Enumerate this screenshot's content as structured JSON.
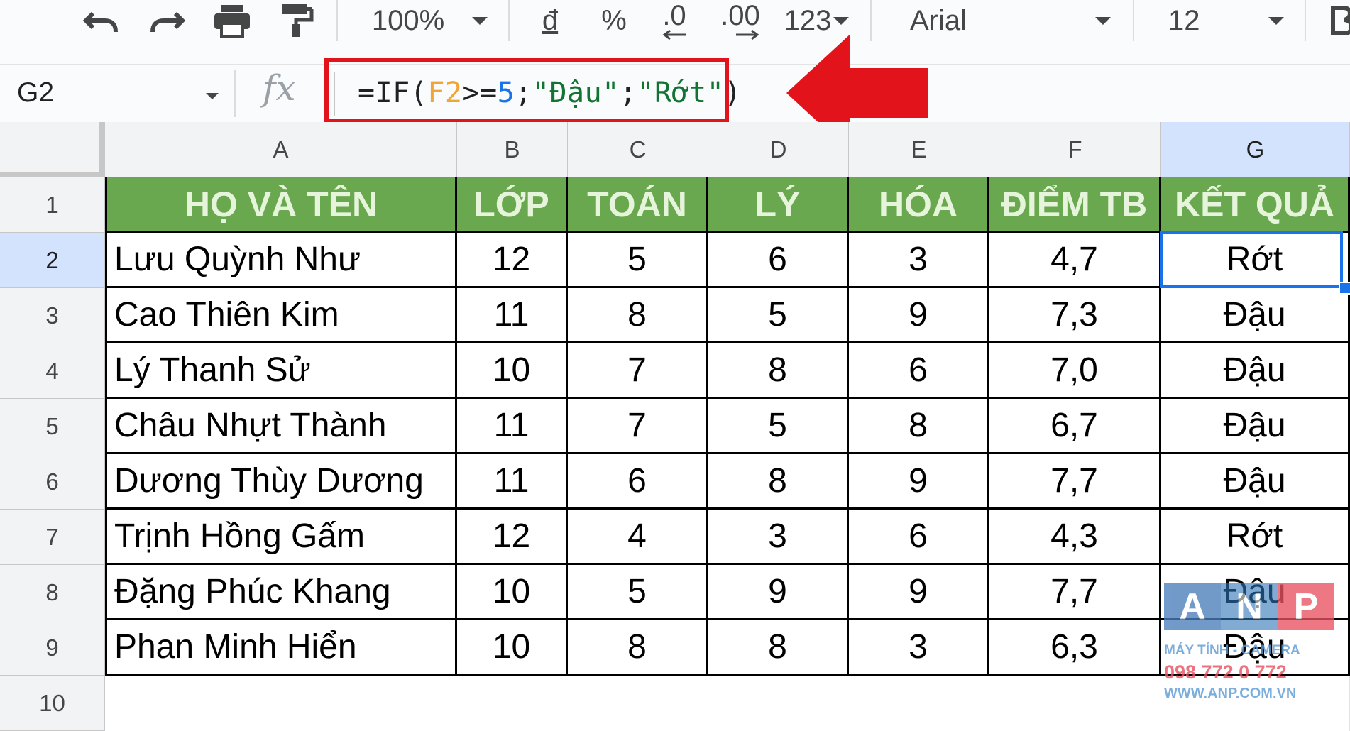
{
  "toolbar": {
    "zoom": "100%",
    "currency": "đ",
    "percent": "%",
    "dec_decrease": ".0",
    "dec_increase": ".00",
    "more_formats": "123",
    "font": "Arial",
    "font_size": "12"
  },
  "formula_bar": {
    "name_box": "G2",
    "fx": "fx",
    "formula_parts": [
      "=IF(",
      "F2",
      ">=",
      "5",
      ";",
      "\"Đậu\"",
      ";",
      "\"Rớt\"",
      ")"
    ]
  },
  "columns": [
    "A",
    "B",
    "C",
    "D",
    "E",
    "F",
    "G"
  ],
  "rows": [
    "1",
    "2",
    "3",
    "4",
    "5",
    "6",
    "7",
    "8",
    "9",
    "10"
  ],
  "header": [
    "HỌ VÀ TÊN",
    "LỚP",
    "TOÁN",
    "LÝ",
    "HÓA",
    "ĐIỂM TB",
    "KẾT QUẢ"
  ],
  "data": [
    [
      "Lưu Quỳnh Như",
      "12",
      "5",
      "6",
      "3",
      "4,7",
      "Rớt"
    ],
    [
      "Cao Thiên Kim",
      "11",
      "8",
      "5",
      "9",
      "7,3",
      "Đậu"
    ],
    [
      "Lý Thanh Sử",
      "10",
      "7",
      "8",
      "6",
      "7,0",
      "Đậu"
    ],
    [
      "Châu Nhựt Thành",
      "11",
      "7",
      "5",
      "8",
      "6,7",
      "Đậu"
    ],
    [
      "Dương Thùy Dương",
      "11",
      "6",
      "8",
      "9",
      "7,7",
      "Đậu"
    ],
    [
      "Trịnh Hồng Gấm",
      "12",
      "4",
      "3",
      "6",
      "4,3",
      "Rớt"
    ],
    [
      "Đặng Phúc Khang",
      "10",
      "5",
      "9",
      "9",
      "7,7",
      "Đậu"
    ],
    [
      "Phan Minh Hiển",
      "10",
      "8",
      "8",
      "3",
      "6,3",
      "Đậu"
    ]
  ],
  "selected_cell": "G2",
  "watermark": {
    "letters": [
      "A",
      "N",
      "P"
    ],
    "line1": "MÁY TÍNH - CAMERA",
    "line2": "098 772 0 772",
    "line3": "WWW.ANP.COM.VN"
  },
  "colors": {
    "header_green": "#6aa84f",
    "selection_blue": "#1a73e8",
    "annotation_red": "#e3131b"
  }
}
